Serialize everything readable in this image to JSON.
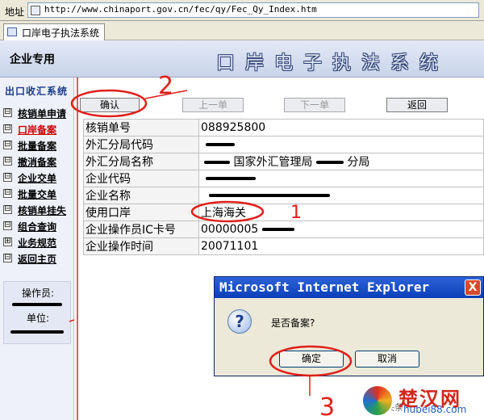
{
  "address_bar": {
    "label": "地址",
    "url": "http://www.chinaport.gov.cn/fec/qy/Fec_Qy_Index.htm"
  },
  "tab": {
    "title": "口岸电子执法系统"
  },
  "banner": {
    "company_use": "企业专用",
    "system_title": "口岸电子执法系统"
  },
  "sidebar": {
    "section_title": "出口收汇系统",
    "items": [
      {
        "label": "核销单申请",
        "box": "⊟",
        "active": false
      },
      {
        "label": "口岸备案",
        "box": "⊟",
        "active": true
      },
      {
        "label": "批量备案",
        "box": "⊟",
        "active": false
      },
      {
        "label": "撤消备案",
        "box": "⊟",
        "active": false
      },
      {
        "label": "企业交单",
        "box": "⊟",
        "active": false
      },
      {
        "label": "批量交单",
        "box": "⊟",
        "active": false
      },
      {
        "label": "核销单挂失",
        "box": "⊟",
        "active": false
      },
      {
        "label": "组合查询",
        "box": "⊟",
        "active": false
      },
      {
        "label": "业务规范",
        "box": "⊞",
        "active": false
      },
      {
        "label": "返回主页",
        "box": "⊟",
        "active": false
      }
    ],
    "operator_label": "操作员:",
    "unit_label": "单位:"
  },
  "toolbar": {
    "confirm": "确认",
    "prev": "上一单",
    "next": "下一单",
    "back": "返回"
  },
  "form": {
    "rows": [
      {
        "key": "核销单号",
        "value": "088925800"
      },
      {
        "key": "外汇分局代码",
        "value": ""
      },
      {
        "key": "外汇分局名称",
        "value": "国家外汇管理局",
        "suffix": "分局"
      },
      {
        "key": "企业代码",
        "value": ""
      },
      {
        "key": "企业名称",
        "value": ""
      },
      {
        "key": "使用口岸",
        "value": "上海海关"
      },
      {
        "key": "企业操作员IC卡号",
        "value": "00000005"
      },
      {
        "key": "企业操作时间",
        "value": "20071101"
      }
    ]
  },
  "dialog": {
    "title": "Microsoft Internet Explorer",
    "close": "X",
    "icon": "?",
    "message": "是否备案?",
    "ok": "确定",
    "cancel": "取消"
  },
  "annotations": {
    "n1": "1",
    "n2": "2",
    "n3": "3"
  },
  "watermark": {
    "name": "楚汉网",
    "domain": "hubei88.com",
    "small": "头条"
  },
  "colors": {
    "annotation_red": "#e0201a",
    "dialog_title_blue": "#0a3fb8",
    "sidebar_head_blue": "#1a3a8c",
    "active_item_red": "#cc0000"
  },
  "icons": {
    "page": "page-icon",
    "tab": "ie-page-icon",
    "question": "question-icon",
    "close": "close-icon"
  }
}
